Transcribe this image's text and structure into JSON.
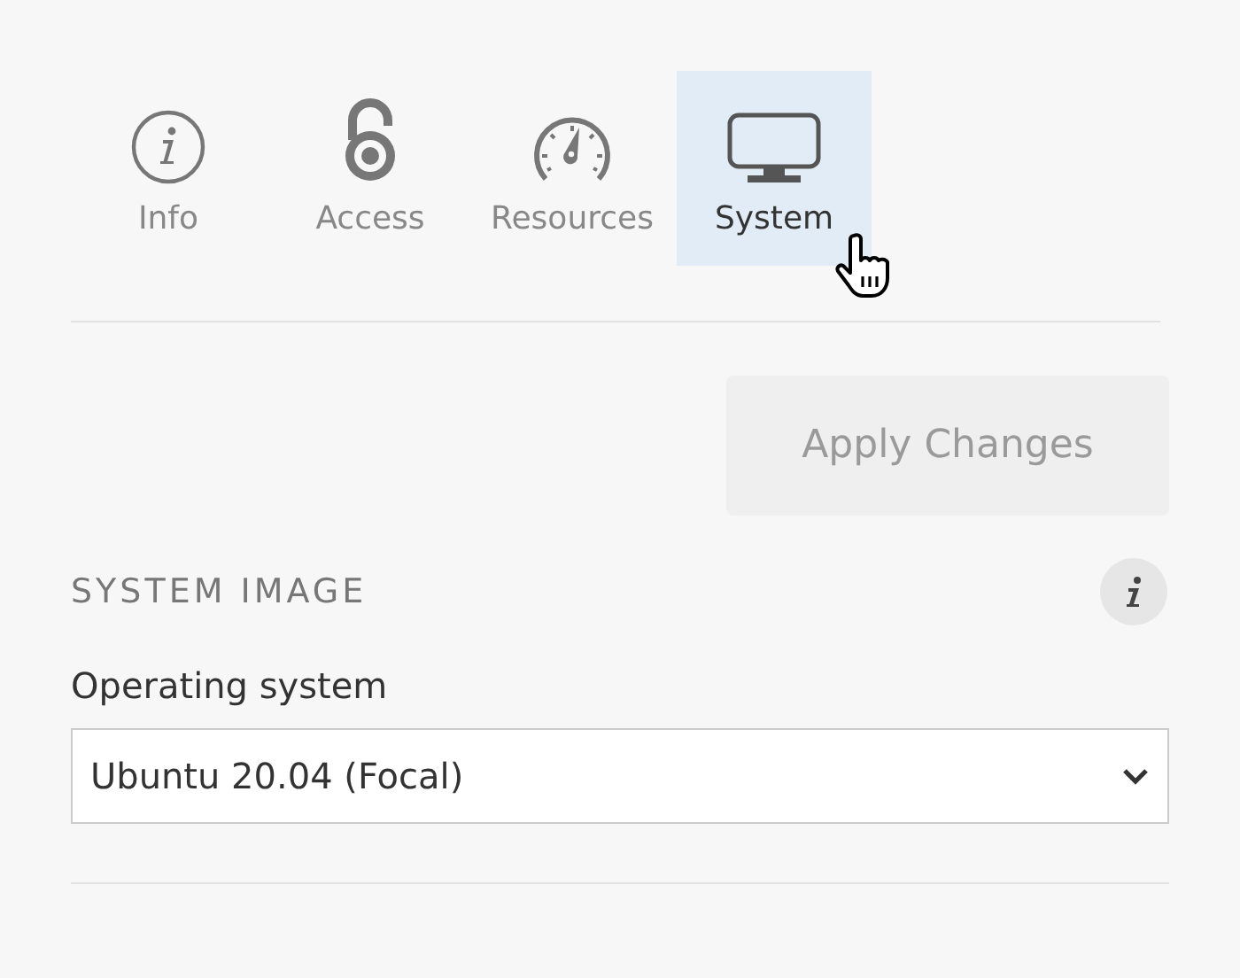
{
  "tabs": [
    {
      "label": "Info",
      "kind": "info",
      "selected": false
    },
    {
      "label": "Access",
      "kind": "lock",
      "selected": false
    },
    {
      "label": "Resources",
      "kind": "gauge",
      "selected": false
    },
    {
      "label": "System",
      "kind": "monitor",
      "selected": true
    }
  ],
  "apply_button": {
    "label": "Apply Changes",
    "disabled": true
  },
  "section": {
    "title": "SYSTEM IMAGE",
    "field_label": "Operating system",
    "select_value": "Ubuntu 20.04 (Focal)"
  }
}
